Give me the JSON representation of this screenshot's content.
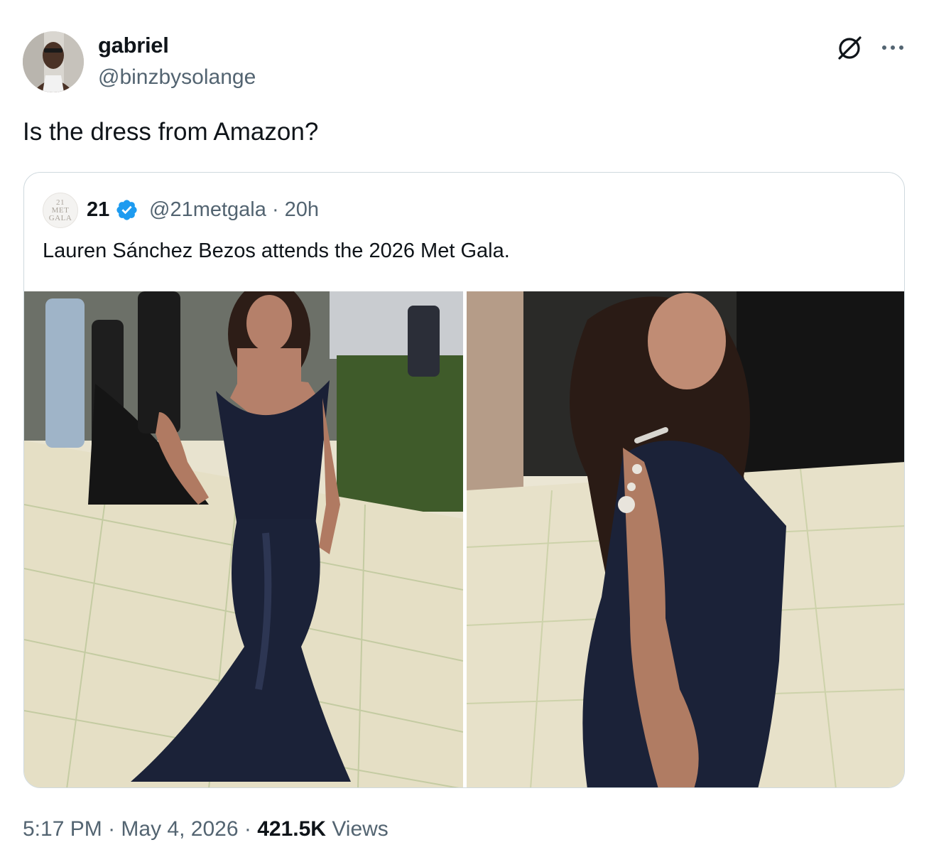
{
  "author": {
    "display_name": "gabriel",
    "handle": "@binzbysolange"
  },
  "tweet": {
    "text": "Is the dress from Amazon?"
  },
  "quoted": {
    "avatar_lines": [
      "21",
      "MET",
      "GALA"
    ],
    "display_name": "21",
    "handle": "@21metgala",
    "separator": "·",
    "time_ago": "20h",
    "text": "Lauren Sánchez Bezos attends the 2026 Met Gala."
  },
  "footer": {
    "time": "5:17 PM",
    "dot1": "·",
    "date": "May 4, 2026",
    "dot2": "·",
    "views_count": "421.5K",
    "views_label": "Views"
  },
  "icons": {
    "grok": "grok-icon",
    "more": "more-icon",
    "verified": "verified-badge-icon"
  },
  "colors": {
    "verified_blue": "#1d9bf0",
    "secondary_text": "#536471",
    "border": "#cfd9de"
  }
}
